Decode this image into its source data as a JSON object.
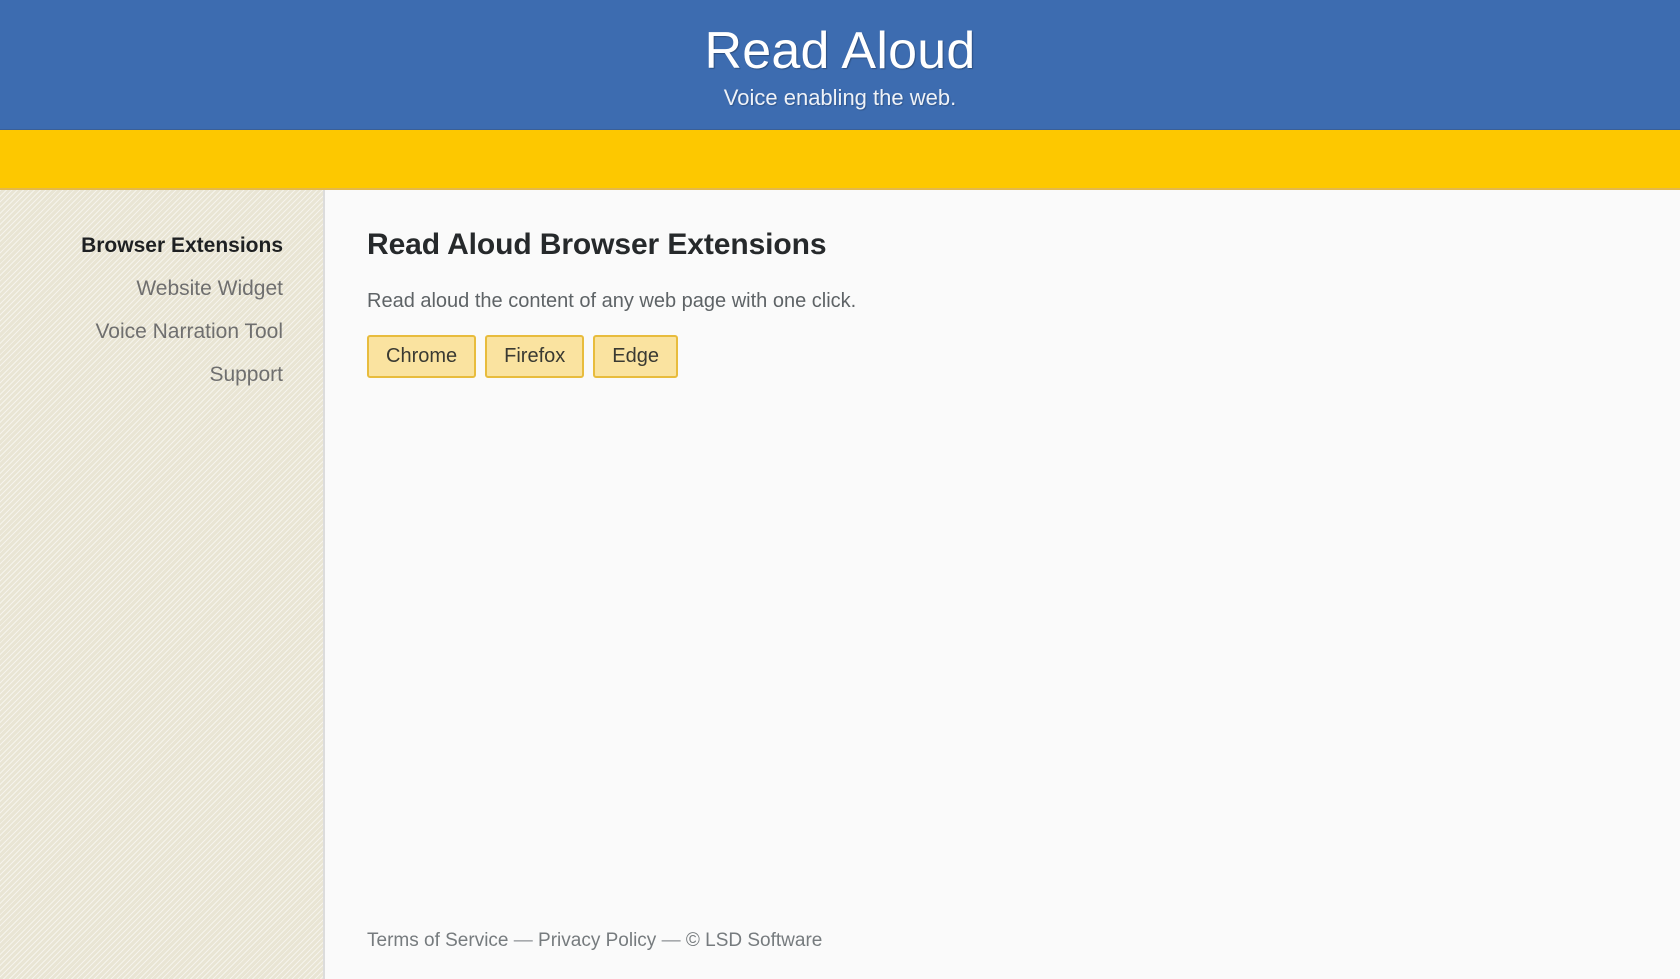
{
  "header": {
    "title": "Read Aloud",
    "tagline": "Voice enabling the web.",
    "background_color": "#3d6cb0",
    "title_color": "#ffffff"
  },
  "nav_bar": {
    "background_color": "#fdc800",
    "border_color": "#e3b84d",
    "items": []
  },
  "sidebar": {
    "background_color": "#e9e5d4",
    "items": [
      {
        "label": "Browser Extensions",
        "active": true
      },
      {
        "label": "Website Widget",
        "active": false
      },
      {
        "label": "Voice Narration Tool",
        "active": false
      },
      {
        "label": "Support",
        "active": false
      }
    ]
  },
  "main": {
    "title": "Read Aloud Browser Extensions",
    "description": "Read aloud the content of any web page with one click.",
    "buttons": [
      {
        "label": "Chrome"
      },
      {
        "label": "Firefox"
      },
      {
        "label": "Edge"
      }
    ],
    "button_fill_color": "#fae3a0",
    "button_border_color": "#e8bc3d"
  },
  "footer": {
    "terms_label": "Terms of Service",
    "separator_1": "—",
    "privacy_label": "Privacy Policy",
    "separator_2": "—",
    "copyright": "© LSD Software"
  }
}
